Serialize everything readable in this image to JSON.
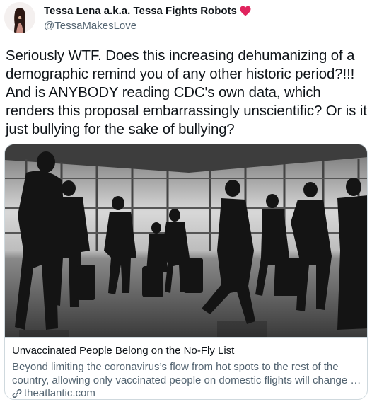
{
  "author": {
    "display_name": "Tessa Lena a.k.a. Tessa Fights Robots",
    "emoji_icon": "red-heart-icon",
    "handle": "@TessaMakesLove"
  },
  "tweet": {
    "text": "Seriously WTF. Does this increasing dehumanizing of a demographic remind you of any other historic period?!!! And is ANYBODY reading CDC's own data, which renders this proposal embarrassingly unscientific? Or is it just bullying for the sake of bullying?"
  },
  "link_card": {
    "title": "Unvaccinated People Belong on the No-Fly List",
    "description": "Beyond limiting the coronavirus’s flow from hot spots to the rest of the country, allowing only vaccinated people on domestic flights will change …",
    "domain": "theatlantic.com",
    "link_icon": "link-icon"
  },
  "colors": {
    "text_primary": "#0f1419",
    "text_secondary": "#536471",
    "border": "#cfd9de",
    "heart": "#e0245e"
  }
}
